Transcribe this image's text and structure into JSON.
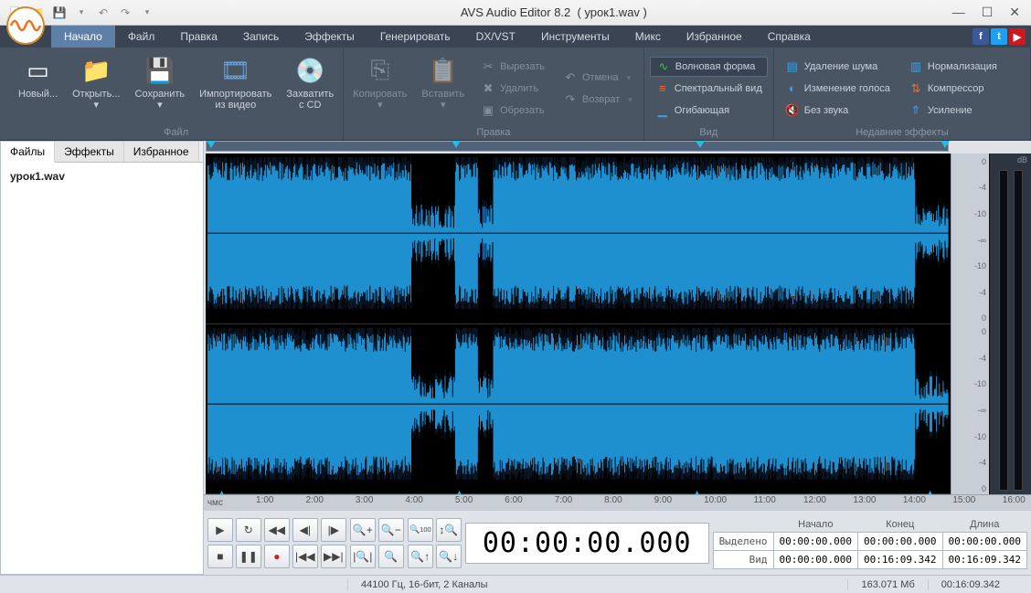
{
  "title": {
    "app": "AVS Audio Editor 8.2",
    "file": "( урок1.wav )"
  },
  "menu": [
    "Начало",
    "Файл",
    "Правка",
    "Запись",
    "Эффекты",
    "Генерировать",
    "DX/VST",
    "Инструменты",
    "Микс",
    "Избранное",
    "Справка"
  ],
  "ribbon": {
    "file": {
      "title": "Файл",
      "new": "Новый...",
      "open": "Открыть...",
      "save": "Сохранить",
      "import": "Импортировать\nиз видео",
      "grab": "Захватить\nс CD"
    },
    "edit": {
      "title": "Правка",
      "copy": "Копировать",
      "paste": "Вставить",
      "cut": "Вырезать",
      "delete": "Удалить",
      "crop": "Обрезать",
      "undo": "Отмена",
      "redo": "Возврат"
    },
    "view": {
      "title": "Вид",
      "waveform": "Волновая форма",
      "spectral": "Спектральный вид",
      "envelope": "Огибающая"
    },
    "fx": {
      "title": "Недавние эффекты",
      "noise": "Удаление шума",
      "pitch": "Изменение голоса",
      "mute": "Без звука",
      "normalize": "Нормализация",
      "compress": "Компрессор",
      "amplify": "Усиление"
    }
  },
  "sidebar": {
    "tabs": [
      "Файлы",
      "Эффекты",
      "Избранное"
    ],
    "file": "урок1.wav"
  },
  "timeline": {
    "unit": "чмс",
    "ticks": [
      "1:00",
      "2:00",
      "3:00",
      "4:00",
      "5:00",
      "6:00",
      "7:00",
      "8:00",
      "9:00",
      "10:00",
      "11:00",
      "12:00",
      "13:00",
      "14:00",
      "15:00",
      "16:00"
    ]
  },
  "scale_db": [
    "0",
    "-4",
    "-10",
    "-∞",
    "-10",
    "-4",
    "0"
  ],
  "timecode": "00:00:00.000",
  "selection": {
    "cols": [
      "Начало",
      "Конец",
      "Длина"
    ],
    "rows": [
      {
        "label": "Выделено",
        "start": "00:00:00.000",
        "end": "00:00:00.000",
        "len": "00:00:00.000"
      },
      {
        "label": "Вид",
        "start": "00:00:00.000",
        "end": "00:16:09.342",
        "len": "00:16:09.342"
      }
    ]
  },
  "status": {
    "format": "44100 Гц, 16-бит, 2 Каналы",
    "size": "163.071 Мб",
    "dur": "00:16:09.342"
  }
}
